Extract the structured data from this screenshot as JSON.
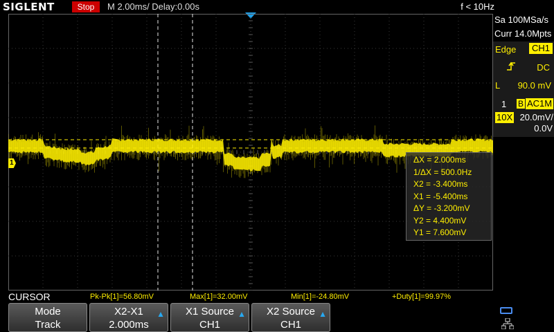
{
  "top_bar": {
    "brand": "SIGLENT",
    "run_state": "Stop",
    "timebase": "M 2.00ms/ Delay:0.00s",
    "frequency": "f < 10Hz"
  },
  "acquisition": {
    "sample_rate": "Sa 100MSa/s",
    "memory_depth": "Curr 14.0Mpts"
  },
  "trigger": {
    "type": "Edge",
    "source": "CH1",
    "slope_icon": "rising-edge-icon",
    "coupling": "DC",
    "level_label": "L",
    "level": "90.0 mV"
  },
  "channel": {
    "number": "1",
    "bw_limit": "B",
    "coupling": "AC1M",
    "probe": "10X",
    "scale": "20.0mV/",
    "offset": "0.0V",
    "marker": "1",
    "color": "#ffef00"
  },
  "cursor_readout": [
    "ΔX = 2.000ms",
    "1/ΔX = 500.0Hz",
    "X2 = -3.400ms",
    "X1 = -5.400ms",
    "ΔY = -3.200mV",
    "Y2 = 4.400mV",
    "Y1 = 7.600mV"
  ],
  "measurements": {
    "pkpk": "Pk-Pk[1]=56.80mV",
    "max": "Max[1]=32.00mV",
    "min": "Min[1]=-24.80mV",
    "duty": "+Duty[1]=99.97%"
  },
  "menu": {
    "title": "CURSOR",
    "softkeys": [
      {
        "line1": "Mode",
        "line2": "Track",
        "arrow": false
      },
      {
        "line1": "X2-X1",
        "line2": "2.000ms",
        "arrow": true
      },
      {
        "line1": "X1 Source",
        "line2": "CH1",
        "arrow": true
      },
      {
        "line1": "X2 Source",
        "line2": "CH1",
        "arrow": true
      }
    ]
  },
  "colors": {
    "trace": "#ffef00",
    "accent": "#1e9fe8",
    "stop_badge": "#cc0000"
  }
}
